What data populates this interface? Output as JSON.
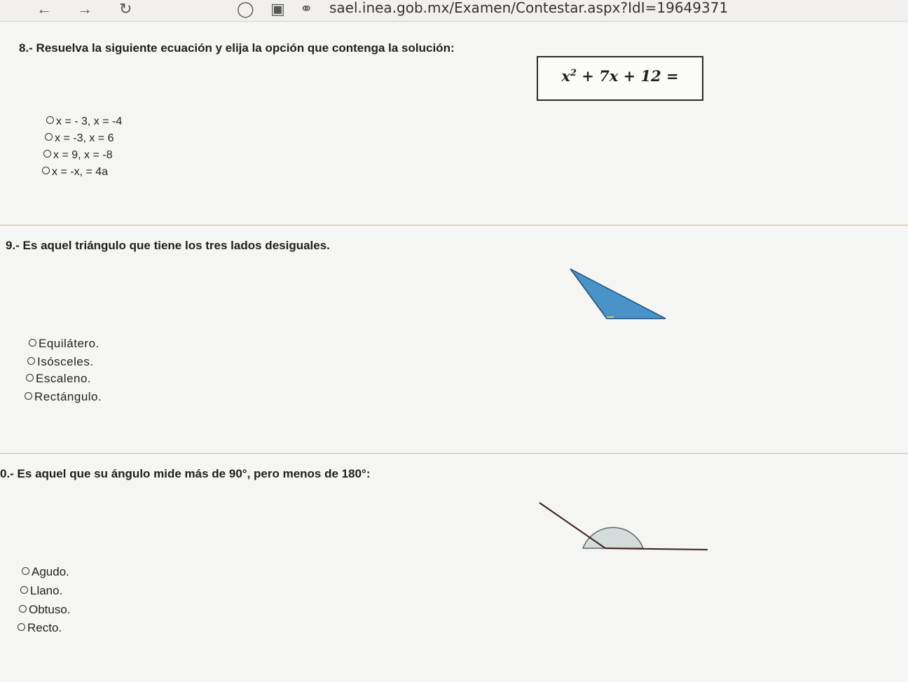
{
  "browser": {
    "url": "sael.inea.gob.mx/Examen/Contestar.aspx?IdI=19649371",
    "back_icon": "arrow-left-icon",
    "forward_icon": "arrow-right-icon",
    "reload_icon": "reload-icon"
  },
  "questions": [
    {
      "title": "8.- Resuelva la siguiente ecuación y elija la opción que contenga la solución:",
      "equation": {
        "lhs": "x",
        "exp": "2",
        "rest": " + 7x + 12 ="
      },
      "options": [
        "x = - 3, x = -4",
        "x = -3, x = 6",
        "x = 9, x = -8",
        "x = -x, = 4a"
      ]
    },
    {
      "title": "9.- Es aquel triángulo que tiene los tres lados desiguales.",
      "options": [
        "Equilátero.",
        "Isósceles.",
        "Escaleno.",
        "Rectángulo."
      ]
    },
    {
      "title": "0.- Es aquel que su ángulo mide más de 90°, pero menos de 180°:",
      "options": [
        "Agudo.",
        "Llano.",
        "Obtuso.",
        "Recto."
      ]
    }
  ],
  "colors": {
    "triangle": "#4a93c9",
    "separator": "#d8b894"
  }
}
